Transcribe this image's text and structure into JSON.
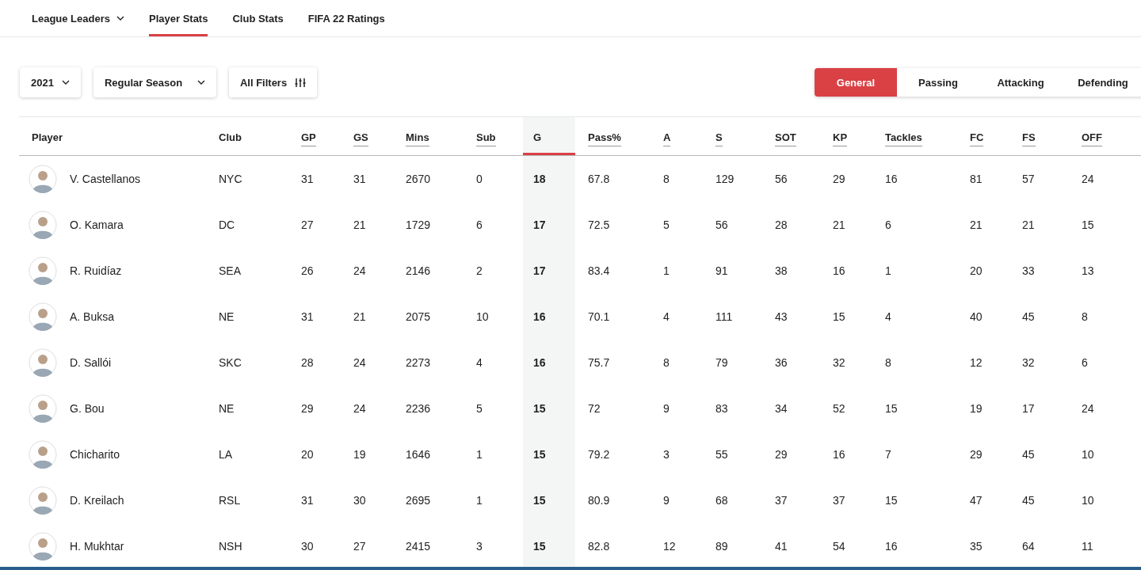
{
  "nav": [
    {
      "label": "League Leaders",
      "dropdown": true,
      "selected": false
    },
    {
      "label": "Player Stats",
      "dropdown": false,
      "selected": true
    },
    {
      "label": "Club Stats",
      "dropdown": false,
      "selected": false
    },
    {
      "label": "FIFA 22 Ratings",
      "dropdown": false,
      "selected": false
    }
  ],
  "filters": [
    {
      "label": "2021",
      "kind": "dropdown"
    },
    {
      "label": "Regular Season",
      "kind": "dropdown"
    },
    {
      "label": "All Filters",
      "kind": "filters"
    }
  ],
  "stat_tabs": [
    {
      "label": "General",
      "selected": true
    },
    {
      "label": "Passing",
      "selected": false
    },
    {
      "label": "Attacking",
      "selected": false
    },
    {
      "label": "Defending",
      "selected": false
    }
  ],
  "table": {
    "columns": [
      {
        "label": "Player",
        "sortable": false,
        "selected": false
      },
      {
        "label": "Club",
        "sortable": false,
        "selected": false
      },
      {
        "label": "GP",
        "sortable": true,
        "selected": false
      },
      {
        "label": "GS",
        "sortable": true,
        "selected": false
      },
      {
        "label": "Mins",
        "sortable": true,
        "selected": false
      },
      {
        "label": "Sub",
        "sortable": true,
        "selected": false
      },
      {
        "label": "G",
        "sortable": true,
        "selected": true
      },
      {
        "label": "Pass%",
        "sortable": true,
        "selected": false
      },
      {
        "label": "A",
        "sortable": true,
        "selected": false
      },
      {
        "label": "S",
        "sortable": true,
        "selected": false
      },
      {
        "label": "SOT",
        "sortable": true,
        "selected": false
      },
      {
        "label": "KP",
        "sortable": true,
        "selected": false
      },
      {
        "label": "Tackles",
        "sortable": true,
        "selected": false
      },
      {
        "label": "FC",
        "sortable": true,
        "selected": false
      },
      {
        "label": "FS",
        "sortable": true,
        "selected": false
      },
      {
        "label": "OFF",
        "sortable": true,
        "selected": false
      }
    ],
    "rows": [
      [
        "V. Castellanos",
        "NYC",
        "31",
        "31",
        "2670",
        "0",
        "18",
        "67.8",
        "8",
        "129",
        "56",
        "29",
        "16",
        "81",
        "57",
        "24"
      ],
      [
        "O. Kamara",
        "DC",
        "27",
        "21",
        "1729",
        "6",
        "17",
        "72.5",
        "5",
        "56",
        "28",
        "21",
        "6",
        "21",
        "21",
        "15"
      ],
      [
        "R. Ruidíaz",
        "SEA",
        "26",
        "24",
        "2146",
        "2",
        "17",
        "83.4",
        "1",
        "91",
        "38",
        "16",
        "1",
        "20",
        "33",
        "13"
      ],
      [
        "A. Buksa",
        "NE",
        "31",
        "21",
        "2075",
        "10",
        "16",
        "70.1",
        "4",
        "111",
        "43",
        "15",
        "4",
        "40",
        "45",
        "8"
      ],
      [
        "D. Sallói",
        "SKC",
        "28",
        "24",
        "2273",
        "4",
        "16",
        "75.7",
        "8",
        "79",
        "36",
        "32",
        "8",
        "12",
        "32",
        "6"
      ],
      [
        "G. Bou",
        "NE",
        "29",
        "24",
        "2236",
        "5",
        "15",
        "72",
        "9",
        "83",
        "34",
        "52",
        "15",
        "19",
        "17",
        "24"
      ],
      [
        "Chicharito",
        "LA",
        "20",
        "19",
        "1646",
        "1",
        "15",
        "79.2",
        "3",
        "55",
        "29",
        "16",
        "7",
        "29",
        "45",
        "10"
      ],
      [
        "D. Kreilach",
        "RSL",
        "31",
        "30",
        "2695",
        "1",
        "15",
        "80.9",
        "9",
        "68",
        "37",
        "37",
        "15",
        "47",
        "45",
        "10"
      ],
      [
        "H. Mukhtar",
        "NSH",
        "30",
        "27",
        "2415",
        "3",
        "15",
        "82.8",
        "12",
        "89",
        "41",
        "54",
        "16",
        "35",
        "64",
        "11"
      ]
    ]
  }
}
